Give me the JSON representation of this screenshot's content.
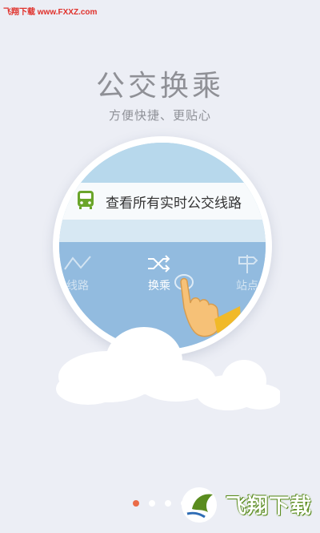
{
  "watermark": {
    "top_text": "飞翔下载 www.FXXZ.com",
    "logo_text": "飞翔下载"
  },
  "page": {
    "title": "公交换乘",
    "subtitle": "方便快捷、更贴心"
  },
  "illustration": {
    "search_text": "查看所有实时公交线路",
    "nav": [
      {
        "label": "线路",
        "icon": "route-icon"
      },
      {
        "label": "换乘",
        "icon": "shuffle-icon"
      },
      {
        "label": "站点",
        "icon": "signpost-icon"
      }
    ]
  },
  "pager": {
    "count": 4,
    "active_index": 0
  },
  "colors": {
    "background": "#eceef5",
    "accent_dot": "#ea6b47",
    "bus_green": "#6aa52a",
    "nav_blue": "#92bbdf"
  }
}
